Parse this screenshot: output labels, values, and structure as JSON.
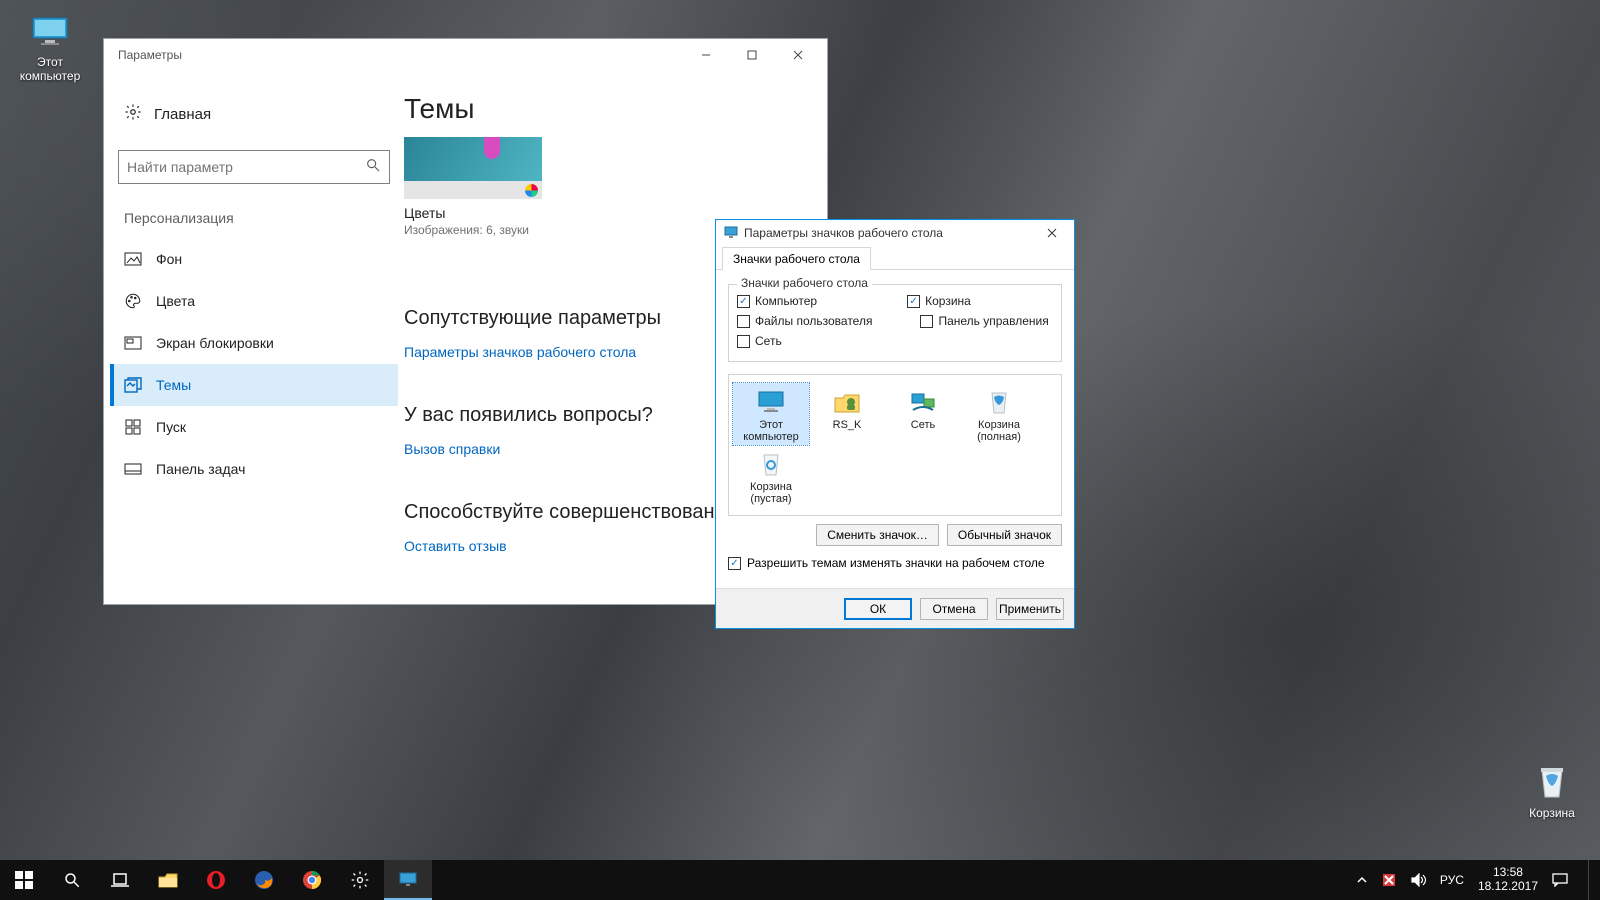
{
  "desktop": {
    "pc_label": "Этот\nкомпьютер",
    "bin_label": "Корзина"
  },
  "settings": {
    "window_title": "Параметры",
    "home_label": "Главная",
    "search_placeholder": "Найти параметр",
    "section_label": "Персонализация",
    "items": [
      {
        "label": "Фон"
      },
      {
        "label": "Цвета"
      },
      {
        "label": "Экран блокировки"
      },
      {
        "label": "Темы"
      },
      {
        "label": "Пуск"
      },
      {
        "label": "Панель задач"
      }
    ],
    "page_title": "Темы",
    "theme": {
      "name": "Цветы",
      "meta": "Изображения: 6, звуки"
    },
    "related_heading": "Сопутствующие параметры",
    "related_link": "Параметры значков рабочего стола",
    "help_heading": "У вас появились вопросы?",
    "help_link": "Вызов справки",
    "feedback_heading": "Способствуйте совершенствованию",
    "feedback_link": "Оставить отзыв"
  },
  "dialog": {
    "title": "Параметры значков рабочего стола",
    "tab": "Значки рабочего стола",
    "fieldset_legend": "Значки рабочего стола",
    "checks": {
      "computer": {
        "label": "Компьютер",
        "checked": true
      },
      "user_files": {
        "label": "Файлы пользователя",
        "checked": false
      },
      "network": {
        "label": "Сеть",
        "checked": false
      },
      "recycle": {
        "label": "Корзина",
        "checked": true
      },
      "cpanel": {
        "label": "Панель управления",
        "checked": false
      }
    },
    "icons": [
      {
        "label": "Этот компьютер"
      },
      {
        "label": "RS_K"
      },
      {
        "label": "Сеть"
      },
      {
        "label": "Корзина (полная)"
      },
      {
        "label": "Корзина (пустая)"
      }
    ],
    "btn_change": "Сменить значок…",
    "btn_default": "Обычный значок",
    "allow_label": "Разрешить темам изменять значки на рабочем столе",
    "allow_checked": true,
    "ok": "ОК",
    "cancel": "Отмена",
    "apply": "Применить"
  },
  "taskbar": {
    "lang": "РУС",
    "time": "13:58",
    "date": "18.12.2017"
  }
}
